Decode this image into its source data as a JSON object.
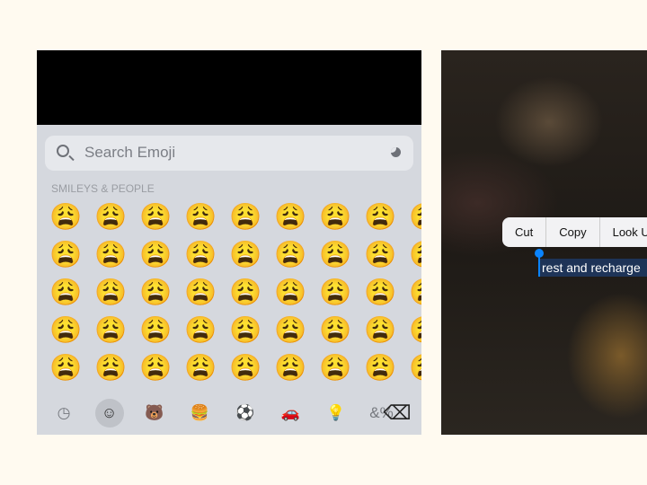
{
  "keyboard": {
    "search_placeholder": "Search Emoji",
    "category_label": "SMILEYS & PEOPLE",
    "emoji": "😩",
    "rows": 5,
    "cols": 9,
    "tabs": [
      {
        "name": "recent-icon",
        "glyph": "◷"
      },
      {
        "name": "smileys-icon",
        "glyph": "☺",
        "selected": true
      },
      {
        "name": "animals-icon",
        "glyph": "🐻"
      },
      {
        "name": "food-icon",
        "glyph": "🍔"
      },
      {
        "name": "activity-icon",
        "glyph": "⚽"
      },
      {
        "name": "travel-icon",
        "glyph": "🚗"
      },
      {
        "name": "objects-icon",
        "glyph": "💡"
      },
      {
        "name": "symbols-icon",
        "glyph": "&%"
      },
      {
        "name": "flags-icon",
        "glyph": "⚐"
      }
    ],
    "delete_glyph": "⌫"
  },
  "context_menu": {
    "items": [
      "Cut",
      "Copy",
      "Look Up"
    ]
  },
  "selected_text": "rest and recharge"
}
